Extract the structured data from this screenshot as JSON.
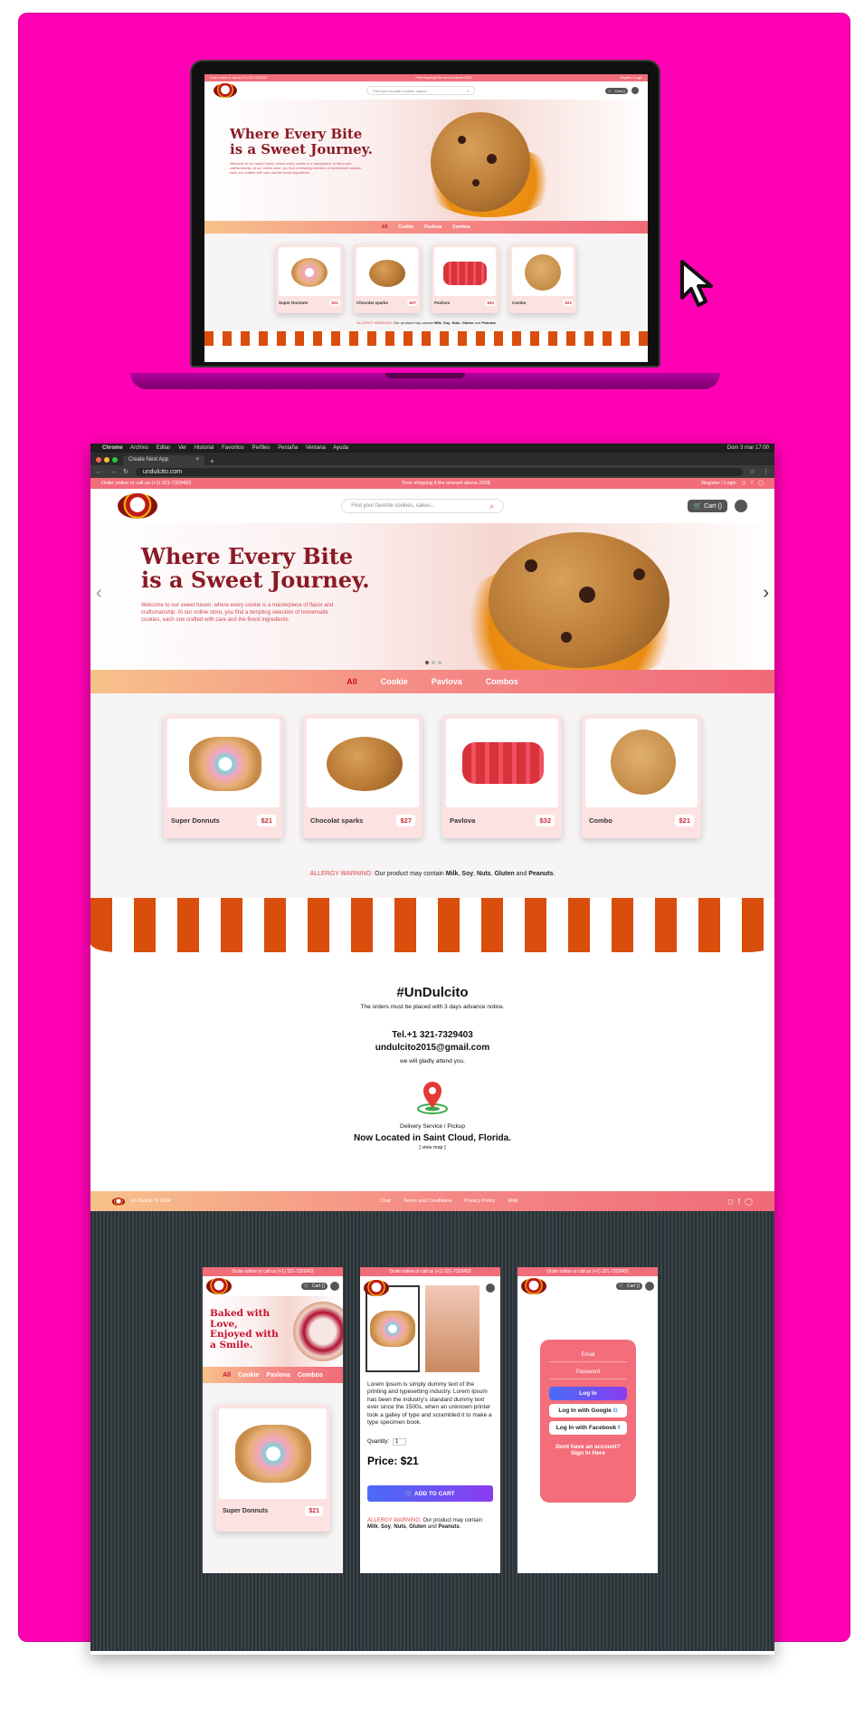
{
  "site": {
    "topbar_left": "Order online or call us (+1) 321-7329403",
    "topbar_center": "Free shipping if the amount above 250$",
    "topbar_right": "Register / Login",
    "search_placeholder": "Find your favorite cookies, cakes...",
    "cart_label": "Cart ()",
    "hero_title_1": "Where Every Bite",
    "hero_title_2": "is a Sweet Journey.",
    "hero_text": "Welcome to our sweet haven, where every cookie is a masterpiece of flavor and craftsmanship. At our online store, you find a tempting selection of homemade cookies, each one crafted with care and the finest ingredients",
    "categories": [
      "All",
      "Cookie",
      "Pavlova",
      "Combos"
    ],
    "products": [
      {
        "name": "Super Donnuts",
        "price": "$21"
      },
      {
        "name": "Chocolat sparks",
        "price": "$27"
      },
      {
        "name": "Pavlova",
        "price": "$32"
      },
      {
        "name": "Combo",
        "price": "$21"
      }
    ],
    "allergy_label": "ALLERGY WARNING:",
    "allergy_text": "Our product may contain",
    "allergens": [
      "Milk",
      "Soy",
      "Nuts",
      "Gluten",
      "Peanuts"
    ],
    "allergy_and": "and"
  },
  "browser": {
    "mac_menus": [
      "Chrome",
      "Archivo",
      "Editar",
      "Ver",
      "Historial",
      "Favoritos",
      "Perfiles",
      "Pestaña",
      "Ventana",
      "Ayuda"
    ],
    "clock": "Dom 3 mar 17:00",
    "tab_title": "Create Next App",
    "url": "undulcito.com"
  },
  "contact": {
    "hashtag": "#UnDulcito",
    "notice": "The orders must be placed with 3 days advance notice.",
    "phone": "Tel.+1 321-7329403",
    "email": "undulcito2015@gmail.com",
    "attend": "we will gladly attend you.",
    "delivery": "Delivery Service / Pickup",
    "location": "Now Located in Saint Cloud, Florida.",
    "view_map": "[ view map ]"
  },
  "footer": {
    "copyright": "Un Dulcito © 2024",
    "links": [
      "Chat",
      "Terms and Conditions",
      "Privacy Policy",
      "Web"
    ]
  },
  "mobile": {
    "hero_title": "Baked with Love, Enjoyed with a Smile.",
    "first_product": "Super Donnuts",
    "first_price": "$21",
    "description": "Lorem Ipsum is simply dummy text of the printing and typesetting industry. Lorem Ipsum has been the industry's standard dummy text ever since the 1500s, when an unknown printer took a galley of type and scrambled it to make a type specimen book.",
    "quantity_label": "Quantity:",
    "quantity_value": "1",
    "price": "Price: $21",
    "add_to_cart": "ADD TO CART",
    "email_label": "Email",
    "password_label": "Password",
    "login": "Log In",
    "login_google": "Log In with Google",
    "login_facebook": "Log In with Facebook",
    "signup": "Dont have an account? Sign In Here"
  },
  "colors": {
    "magenta": "#ff00b4",
    "brand_coral": "#f26d7a",
    "hero_title": "#8b1a24",
    "awning_orange": "#d94e0c"
  }
}
